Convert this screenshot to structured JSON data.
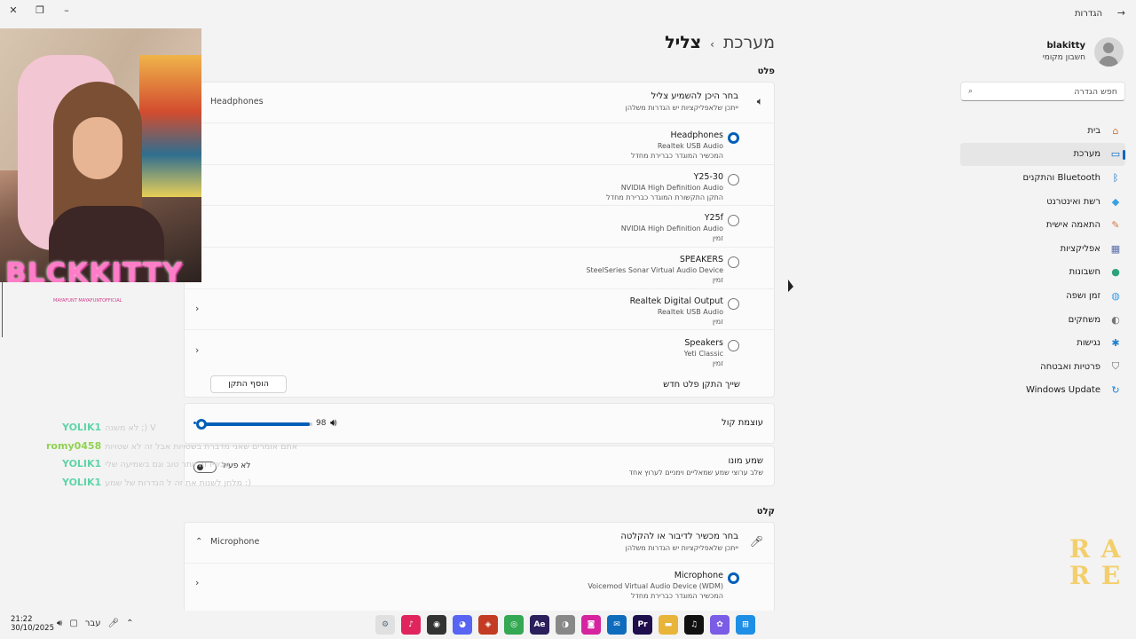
{
  "window": {
    "title": "הגדרות",
    "close_glyph": "✕",
    "restore_glyph": "❐",
    "minimize_glyph": "–",
    "back_glyph": "→"
  },
  "user": {
    "name": "blakitty",
    "account": "חשבון מקומי"
  },
  "search": {
    "placeholder": "חפש הגדרה",
    "icon": "search-icon"
  },
  "nav": [
    {
      "label": "בית",
      "icon": "home-icon",
      "glyph": "⌂",
      "color": "#d9773e",
      "active": false
    },
    {
      "label": "מערכת",
      "icon": "system-icon",
      "glyph": "▭",
      "color": "#0067c0",
      "active": true
    },
    {
      "label": "Bluetooth והתקנים",
      "icon": "bluetooth-icon",
      "glyph": "ᛒ",
      "color": "#0067c0",
      "active": false
    },
    {
      "label": "רשת ואינטרנט",
      "icon": "network-icon",
      "glyph": "◆",
      "color": "#3aa0e6",
      "active": false
    },
    {
      "label": "התאמה אישית",
      "icon": "brush-icon",
      "glyph": "✎",
      "color": "#d9773e",
      "active": false
    },
    {
      "label": "אפליקציות",
      "icon": "apps-icon",
      "glyph": "▦",
      "color": "#5a6ea8",
      "active": false
    },
    {
      "label": "חשבונות",
      "icon": "accounts-icon",
      "glyph": "●",
      "color": "#2ea27a",
      "active": false
    },
    {
      "label": "זמן ושפה",
      "icon": "globe-icon",
      "glyph": "◍",
      "color": "#3aa0e6",
      "active": false
    },
    {
      "label": "משחקים",
      "icon": "gamepad-icon",
      "glyph": "◐",
      "color": "#777777",
      "active": false
    },
    {
      "label": "נגישות",
      "icon": "accessibility-icon",
      "glyph": "✱",
      "color": "#1f7fd0",
      "active": false
    },
    {
      "label": "פרטיות ואבטחה",
      "icon": "shield-icon",
      "glyph": "⛉",
      "color": "#666666",
      "active": false
    },
    {
      "label": "Windows Update",
      "icon": "update-icon",
      "glyph": "↻",
      "color": "#1f7fd0",
      "active": false
    }
  ],
  "breadcrumb": {
    "parent": "מערכת",
    "separator": "›",
    "current": "צליל"
  },
  "output": {
    "section_title": "פלט",
    "header_title": "בחר היכן להשמיע צליל",
    "header_sub": "ייתכן שלאפליקציות יש הגדרות משלהן",
    "header_value": "Headphones",
    "header_icon": "speaker-icon",
    "devices": [
      {
        "name": "Headphones",
        "driver": "Realtek USB Audio",
        "status": "המכשיר המוגדר כברירת מחדל",
        "selected": true,
        "chevron": false
      },
      {
        "name": "Y25-30",
        "driver": "NVIDIA High Definition Audio",
        "status": "התקן התקשורת המוגדר כברירת מחדל",
        "selected": false,
        "chevron": false
      },
      {
        "name": "Y25f",
        "driver": "NVIDIA High Definition Audio",
        "status": "זמין",
        "selected": false,
        "chevron": false
      },
      {
        "name": "SPEAKERS",
        "driver": "SteelSeries Sonar Virtual Audio Device",
        "status": "זמין",
        "selected": false,
        "chevron": false
      },
      {
        "name": "Realtek Digital Output",
        "driver": "Realtek USB Audio",
        "status": "זמין",
        "selected": false,
        "chevron": true
      },
      {
        "name": "Speakers",
        "driver": "Yeti Classic",
        "status": "זמין",
        "selected": false,
        "chevron": true
      }
    ],
    "pair_label": "שייך התקן פלט חדש",
    "add_device_label": "הוסף התקן",
    "volume_label": "עוצמת קול",
    "volume_value": 98,
    "mono_title": "שמע מונו",
    "mono_sub": "שלב ערוצי שמע שמאליים וימניים לערוץ אחד",
    "mono_state": "לא פעיל"
  },
  "input": {
    "section_title": "קלט",
    "header_title": "בחר מכשיר לדיבור או להקלטה",
    "header_sub": "ייתכן שלאפליקציות יש הגדרות משלהן",
    "header_value": "Microphone",
    "header_icon": "microphone-icon",
    "devices": [
      {
        "name": "Microphone",
        "driver": "Voicemod Virtual Audio Device (WDM)",
        "status": "המכשיר המוגדר כברירת מחדל",
        "selected": true,
        "chevron": true
      }
    ]
  },
  "stream_overlay": {
    "name": "BLCKKITTY",
    "socials": "MAYAFUNT   MAYAFUNTOFFICIAL",
    "chat": [
      {
        "user": "YOLIK1",
        "color": "#5fd3a8",
        "message": "לא משנה ;) V"
      },
      {
        "user": "romy0458",
        "color": "#8fd14f",
        "message": "אתם אומרים שאני מדברת בשטויות אבל זה לא שטויות"
      },
      {
        "user": "YOLIK1",
        "color": "#5fd3a8",
        "message": "עכשיו זה יותר טוב וגם בשמיעה שלי"
      },
      {
        "user": "YOLIK1",
        "color": "#5fd3a8",
        "message": "מלחן לשנות את זה ל הגדרות של שמע :)"
      }
    ],
    "logo_letters": [
      "R",
      "A",
      "R",
      "E"
    ]
  },
  "taskbar": {
    "time": "21:22",
    "date": "30/10/2025",
    "language": "עבר",
    "apps": [
      {
        "name": "settings-app",
        "glyph": "⚙",
        "color": "#5a6b7c",
        "active": true
      },
      {
        "name": "tiktok-studio-app",
        "glyph": "♪",
        "color": "#e0245e",
        "active": false
      },
      {
        "name": "obs-app",
        "glyph": "◉",
        "color": "#333333",
        "active": false
      },
      {
        "name": "discord-app",
        "glyph": "◕",
        "color": "#5865f2",
        "active": false
      },
      {
        "name": "red-app",
        "glyph": "◈",
        "color": "#c23b22",
        "active": false
      },
      {
        "name": "chrome-app",
        "glyph": "◎",
        "color": "#34a853",
        "active": false
      },
      {
        "name": "after-effects-app",
        "glyph": "Ae",
        "color": "#2b1f5c",
        "active": false
      },
      {
        "name": "gray-app",
        "glyph": "◑",
        "color": "#888888",
        "active": false
      },
      {
        "name": "instagram-app",
        "glyph": "◙",
        "color": "#d6249f",
        "active": false
      },
      {
        "name": "outlook-app",
        "glyph": "✉",
        "color": "#0f6cbd",
        "active": false
      },
      {
        "name": "premiere-app",
        "glyph": "Pr",
        "color": "#1f0f4d",
        "active": false
      },
      {
        "name": "file-explorer-app",
        "glyph": "▬",
        "color": "#e8b43a",
        "active": false
      },
      {
        "name": "tiktok-app",
        "glyph": "♫",
        "color": "#111111",
        "active": false
      },
      {
        "name": "copilot-app",
        "glyph": "✿",
        "color": "#7b5ce6",
        "active": false
      },
      {
        "name": "start-app",
        "glyph": "⊞",
        "color": "#1f8fe6",
        "active": false
      }
    ]
  }
}
